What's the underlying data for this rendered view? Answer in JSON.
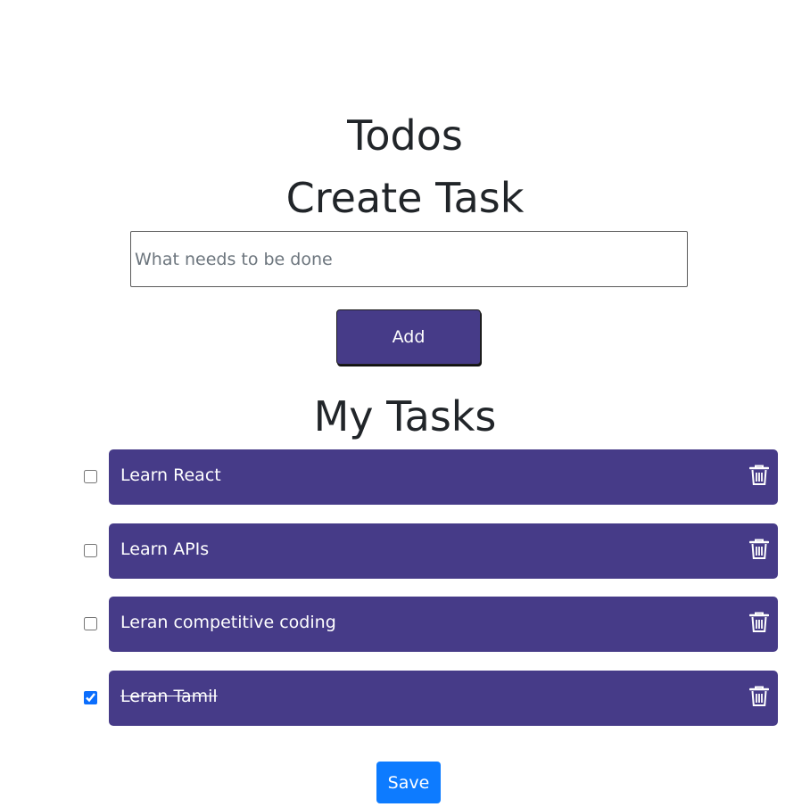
{
  "header": {
    "title": "Todos",
    "create_heading": "Create Task"
  },
  "input": {
    "placeholder": "What needs to be done",
    "value": ""
  },
  "add_button": {
    "label": "Add"
  },
  "tasks_heading": "My Tasks",
  "tasks": [
    {
      "label": "Learn React",
      "checked": false,
      "delete_icon": "trash-icon"
    },
    {
      "label": "Learn APIs",
      "checked": false,
      "delete_icon": "trash-icon"
    },
    {
      "label": "Leran competitive coding",
      "checked": false,
      "delete_icon": "trash-icon"
    },
    {
      "label": "Leran Tamil",
      "checked": true,
      "delete_icon": "trash-icon"
    }
  ],
  "save_button": {
    "label": "Save"
  },
  "colors": {
    "card": "#463b88",
    "save": "#0d7bff",
    "text": "#212529"
  }
}
